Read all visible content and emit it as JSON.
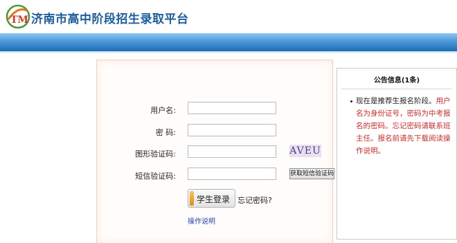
{
  "header": {
    "logo_text": "TM",
    "title": "济南市高中阶段招生录取平台"
  },
  "colors": {
    "title": "#1a5e9e",
    "band_dark": "#1f6cb5",
    "band_light": "#8ec6f0",
    "notice_red": "#d42b2b",
    "help_link": "#2b3fb7"
  },
  "login": {
    "username_label": "用户名:",
    "password_label": "密  码:",
    "captcha_label": "图形验证码:",
    "captcha_image_text": "AVEU",
    "sms_label": "短信验证码:",
    "sms_button": "获取短信验证码",
    "username_value": "",
    "password_value": "",
    "captcha_value": "",
    "sms_value": "",
    "login_button": "学生登录",
    "forgot_password": "忘记密码?",
    "help_link": "操作说明"
  },
  "notice": {
    "title": "公告信息(1条)",
    "item_black": "现在是推荐生报名阶段。",
    "item_red": "用户名为身份证号，密码为中考报名的密码。忘记密码请联系班主任。报名前请先下载阅读操作说明。"
  }
}
